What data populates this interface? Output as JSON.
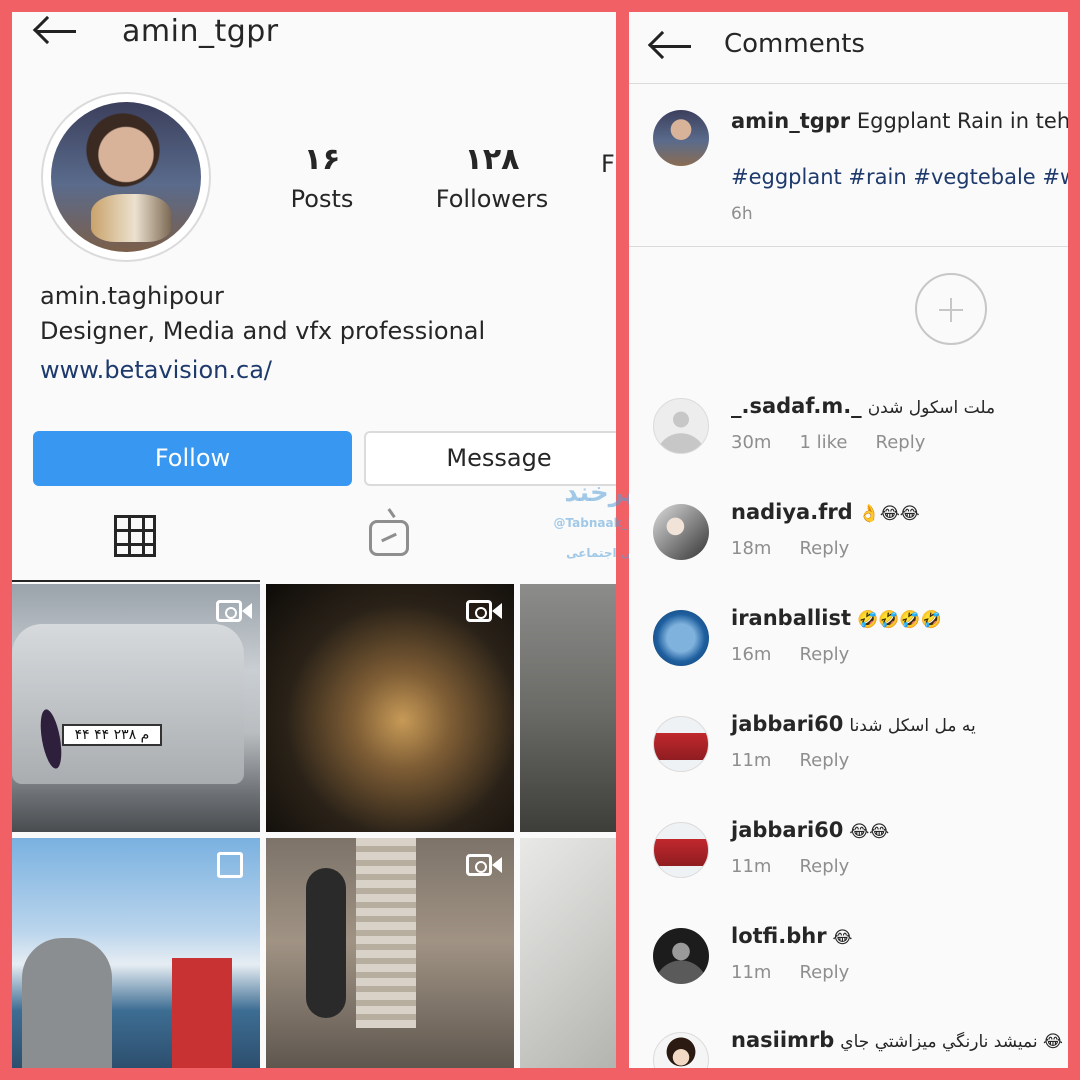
{
  "profile": {
    "username": "amin_tgpr",
    "stats": [
      {
        "value": "۱۶",
        "label": "Posts"
      },
      {
        "value": "۱۲۸",
        "label": "Followers"
      },
      {
        "value": "",
        "label": "F"
      }
    ],
    "name": "amin.taghipour",
    "bio": "Designer, Media and vfx professional",
    "link": "www.betavision.ca/",
    "follow_label": "Follow",
    "message_label": "Message",
    "plate_text": "۴۴ م ۲۳۸ ۴۴"
  },
  "watermark": {
    "line1": "شهرخند",
    "line2": "@Tabnaak_Bolaghi",
    "line3": "سیاسی اجتماعی"
  },
  "comments_view": {
    "title": "Comments",
    "caption": {
      "username": "amin_tgpr",
      "text": "Eggplant Rain in tehran",
      "tags": "#eggplant #rain #vegtebale #weather",
      "time": "6h"
    },
    "reply_label": "Reply",
    "items": [
      {
        "user": "_.sadaf.m._",
        "text": "ملت اسکول شدن",
        "time": "30m",
        "likes": "1 like"
      },
      {
        "user": "nadiya.frd",
        "text": "👌😂😂",
        "time": "18m",
        "likes": ""
      },
      {
        "user": "iranballist",
        "text": "🤣🤣🤣🤣",
        "time": "16m",
        "likes": ""
      },
      {
        "user": "jabbari60",
        "text": "یه مل اسکل شدنا",
        "time": "11m",
        "likes": ""
      },
      {
        "user": "jabbari60",
        "text": "😂😂",
        "time": "11m",
        "likes": ""
      },
      {
        "user": "lotfi.bhr",
        "text": "😂",
        "time": "11m",
        "likes": ""
      },
      {
        "user": "nasiimrb",
        "text": "نميشد نارنگي ميزاشتي جاي 😂",
        "time": "",
        "likes": ""
      }
    ]
  },
  "colors": {
    "follow": "#3897f0",
    "frame": "#f06065",
    "link": "#1e3a6d"
  }
}
